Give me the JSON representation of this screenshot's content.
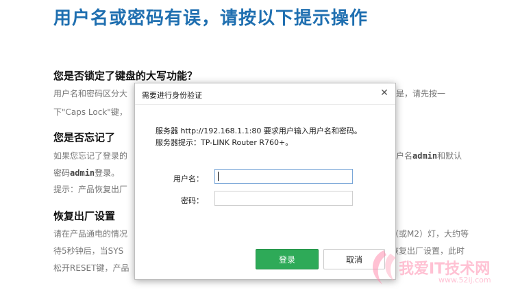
{
  "page": {
    "title": "用户名或密码有误，请按以下提示操作",
    "sections": [
      {
        "heading": "您是否锁定了键盘的大写功能？",
        "line1_left": "用户名和密码区分大",
        "line1_right": "是，请先按一",
        "line2": "下\"Caps Lock\"键，"
      },
      {
        "heading": "您是否忘记了",
        "line1_left": "如果您忘记了登录的",
        "line1_right_pre": "户名",
        "line1_right_bold": "admin",
        "line1_right_post": "和默认",
        "line2_pre": "密码",
        "line2_bold": "admin",
        "line2_post": "登录。",
        "line3": "提示：产品恢复出厂"
      },
      {
        "heading": "恢复出厂设置",
        "line1_left": "请在产品通电的情况",
        "line1_right": "（或M2）灯，大约等",
        "line2_left": "待5秒钟后，当SYS",
        "line2_right": "恢复出厂设置，此时",
        "line3_left": "松开RESET键，产品"
      }
    ]
  },
  "dialog": {
    "title": "需要进行身份验证",
    "close_symbol": "✕",
    "message1": "服务器 http://192.168.1.1:80 要求用户输入用户名和密码。",
    "message2": "服务器提示：TP-LINK Router R760+。",
    "username_label": "用户名：",
    "password_label": "密码：",
    "username_value": "",
    "password_value": "",
    "login_label": "登录",
    "cancel_label": "取消"
  },
  "watermark": {
    "text": "我爱IT技术网",
    "url": "www.52ij.com"
  },
  "colors": {
    "title_blue": "#1f6fb0",
    "login_green": "#2eaa58"
  }
}
